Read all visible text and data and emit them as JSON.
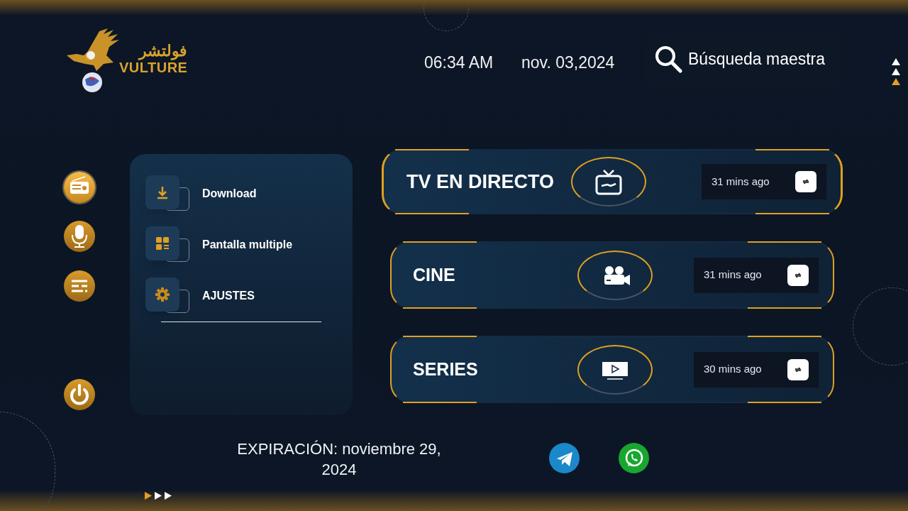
{
  "logo": {
    "arabic_text": "فولتشر",
    "text": "VULTURE"
  },
  "header": {
    "time": "06:34 AM",
    "date": "nov. 03,2024",
    "search": {
      "label": "Búsqueda maestra"
    }
  },
  "side_buttons": [
    {
      "kind": "radio",
      "selected": true
    },
    {
      "kind": "mic",
      "selected": false
    },
    {
      "kind": "list",
      "selected": false
    },
    {
      "kind": "power",
      "selected": false
    }
  ],
  "menu": [
    {
      "kind": "download",
      "label": "Download"
    },
    {
      "kind": "multiscreen",
      "label": "Pantalla multiple"
    },
    {
      "kind": "settings",
      "label": "AJUSTES"
    }
  ],
  "categories": [
    {
      "kind": "tv",
      "title": "TV EN DIRECTO",
      "updated": "31 mins ago",
      "selected": true
    },
    {
      "kind": "movie",
      "title": "CINE",
      "updated": "31 mins ago",
      "selected": false
    },
    {
      "kind": "series",
      "title": "SERIES",
      "updated": "30 mins ago",
      "selected": false
    }
  ],
  "expiration": "EXPIRACIÓN: noviembre 29, 2024",
  "social": [
    {
      "kind": "telegram"
    },
    {
      "kind": "whatsapp"
    }
  ]
}
